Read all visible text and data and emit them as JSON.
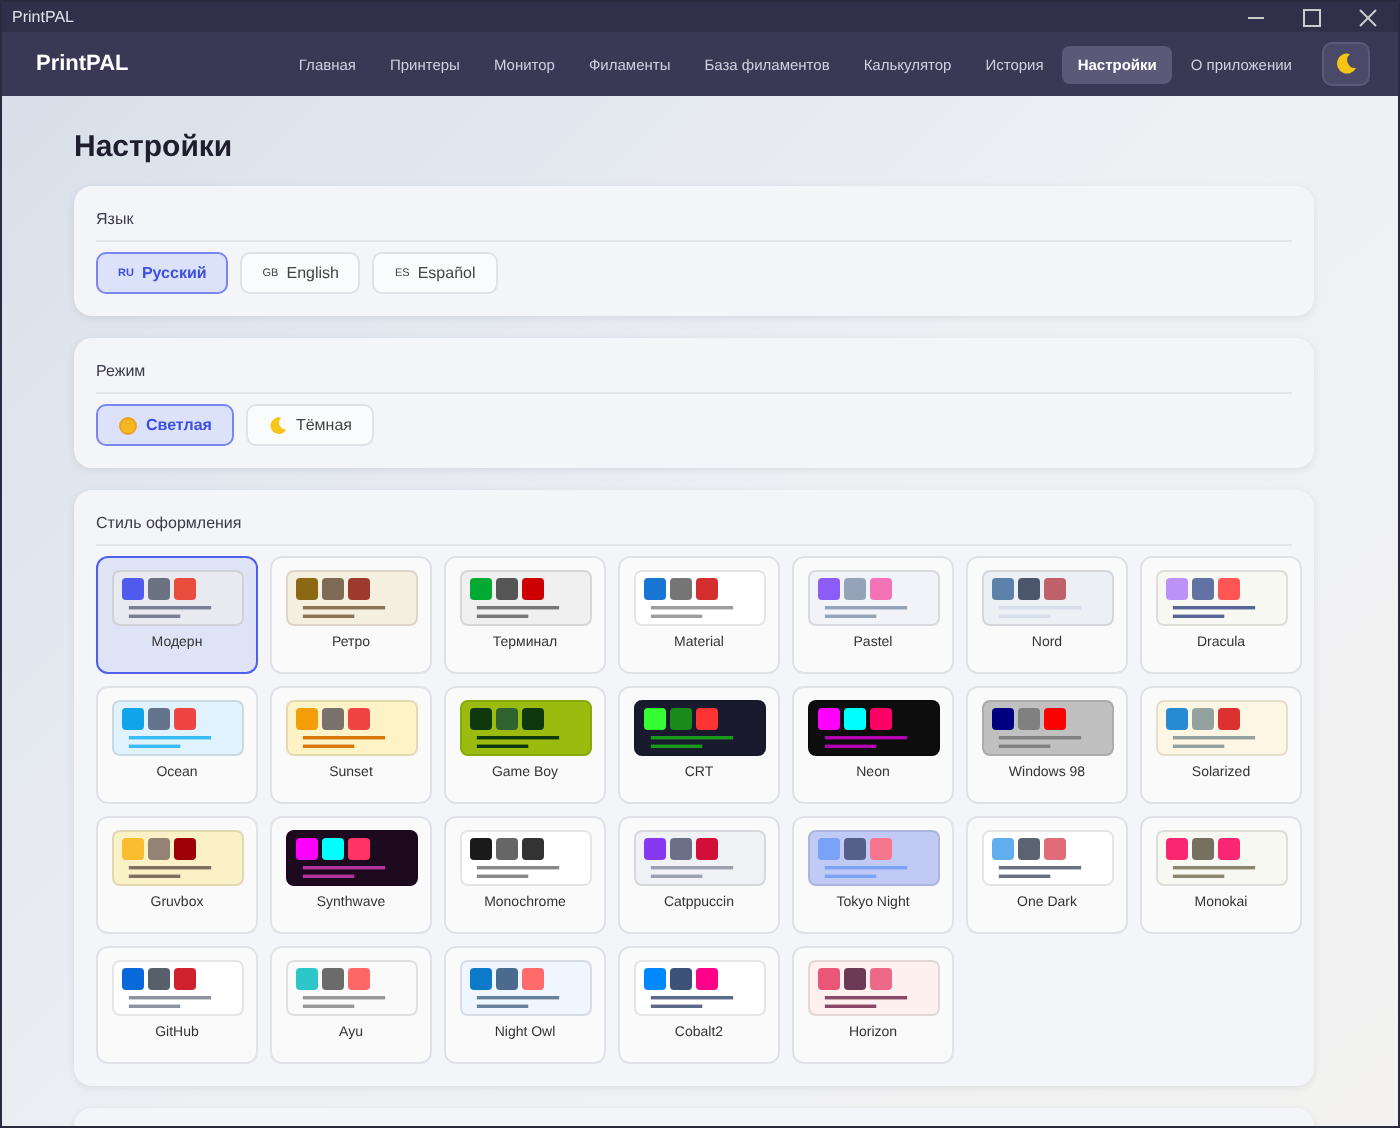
{
  "window": {
    "title": "PrintPAL"
  },
  "app_name": "PrintPAL",
  "nav": [
    {
      "label": "Главная",
      "selected": false
    },
    {
      "label": "Принтеры",
      "selected": false
    },
    {
      "label": "Монитор",
      "selected": false
    },
    {
      "label": "Филаменты",
      "selected": false
    },
    {
      "label": "База филаментов",
      "selected": false
    },
    {
      "label": "Калькулятор",
      "selected": false
    },
    {
      "label": "История",
      "selected": false
    },
    {
      "label": "Настройки",
      "selected": true
    },
    {
      "label": "О приложении",
      "selected": false
    }
  ],
  "page_title": "Настройки",
  "language": {
    "title": "Язык",
    "options": [
      {
        "flag": "RU",
        "label": "Русский",
        "selected": true
      },
      {
        "flag": "GB",
        "label": "English",
        "selected": false
      },
      {
        "flag": "ES",
        "label": "Español",
        "selected": false
      }
    ]
  },
  "mode": {
    "title": "Режим",
    "options": [
      {
        "kind": "sun",
        "label": "Светлая",
        "selected": true
      },
      {
        "kind": "moon",
        "label": "Тёмная",
        "selected": false
      }
    ]
  },
  "style": {
    "title": "Стиль оформления",
    "themes": [
      {
        "name": "Модерн",
        "selected": true,
        "preview": {
          "color": "#e8eaf0"
        },
        "swatches": [
          {
            "color": "#4f5bef"
          },
          {
            "color": "#6b7280"
          },
          {
            "color": "#e74c3c"
          }
        ],
        "line": {
          "color": "#7a7f96"
        }
      },
      {
        "name": "Ретро",
        "selected": false,
        "preview": {
          "color": "#f5efe0"
        },
        "swatches": [
          {
            "color": "#8b6914"
          },
          {
            "color": "#7d6b55"
          },
          {
            "color": "#9c3a2e"
          }
        ],
        "line": {
          "color": "#8b7355"
        }
      },
      {
        "name": "Терминал",
        "selected": false,
        "preview": {
          "color": "#f0f0f0"
        },
        "swatches": [
          {
            "color": "#00aa33"
          },
          {
            "color": "#555555"
          },
          {
            "color": "#cc0000"
          }
        ],
        "line": {
          "color": "#777777"
        }
      },
      {
        "name": "Material",
        "selected": false,
        "preview": {
          "color": "#ffffff"
        },
        "swatches": [
          {
            "color": "#1976d2"
          },
          {
            "color": "#757575"
          },
          {
            "color": "#d32f2f"
          }
        ],
        "line": {
          "color": "#9e9e9e"
        }
      },
      {
        "name": "Pastel",
        "selected": false,
        "preview": {
          "color": "#f1f3f8"
        },
        "swatches": [
          {
            "color": "#8b5cf6"
          },
          {
            "color": "#94a3b8"
          },
          {
            "color": "#f472b6"
          }
        ],
        "line": {
          "color": "#94a3b8"
        }
      },
      {
        "name": "Nord",
        "selected": false,
        "preview": {
          "color": "#eceff4"
        },
        "swatches": [
          {
            "color": "#5e81ac"
          },
          {
            "color": "#4c566a"
          },
          {
            "color": "#bf616a"
          }
        ],
        "line": {
          "color": "#d8dee9"
        }
      },
      {
        "name": "Dracula",
        "selected": false,
        "preview": {
          "color": "#f8f8f2"
        },
        "swatches": [
          {
            "color": "#bd93f9"
          },
          {
            "color": "#6272a4"
          },
          {
            "color": "#ff5555"
          }
        ],
        "line": {
          "color": "#5a6496"
        }
      },
      {
        "name": "Ocean",
        "selected": false,
        "preview": {
          "color": "#e0f2fe"
        },
        "swatches": [
          {
            "color": "#0ea5e9"
          },
          {
            "color": "#64748b"
          },
          {
            "color": "#ef4444"
          }
        ],
        "line": {
          "color": "#38bdf8"
        }
      },
      {
        "name": "Sunset",
        "selected": false,
        "preview": {
          "color": "#fef3c7"
        },
        "swatches": [
          {
            "color": "#f59e0b"
          },
          {
            "color": "#78716c"
          },
          {
            "color": "#ef4444"
          }
        ],
        "line": {
          "color": "#d97706"
        }
      },
      {
        "name": "Game Boy",
        "selected": false,
        "preview": {
          "color": "#9bbc0f"
        },
        "swatches": [
          {
            "color": "#0f380f"
          },
          {
            "color": "#306230"
          },
          {
            "color": "#0f380f"
          }
        ],
        "line": {
          "color": "#0f380f"
        }
      },
      {
        "name": "CRT",
        "selected": false,
        "preview": {
          "color": "#1a1a2e"
        },
        "swatches": [
          {
            "color": "#33ff33"
          },
          {
            "color": "#1a8a1a"
          },
          {
            "color": "#ff3333"
          }
        ],
        "line": {
          "color": "#1a9a1a"
        }
      },
      {
        "name": "Neon",
        "selected": false,
        "preview": {
          "color": "#0d0d0d"
        },
        "swatches": [
          {
            "color": "#ff00ff"
          },
          {
            "color": "#00ffff"
          },
          {
            "color": "#ff0066"
          }
        ],
        "line": {
          "color": "#b000b0"
        }
      },
      {
        "name": "Windows 98",
        "selected": false,
        "preview": {
          "color": "#c0c0c0"
        },
        "swatches": [
          {
            "color": "#000080"
          },
          {
            "color": "#808080"
          },
          {
            "color": "#ff0000"
          }
        ],
        "line": {
          "color": "#808080"
        }
      },
      {
        "name": "Solarized",
        "selected": false,
        "preview": {
          "color": "#fdf6e3"
        },
        "swatches": [
          {
            "color": "#268bd2"
          },
          {
            "color": "#93a1a1"
          },
          {
            "color": "#dc322f"
          }
        ],
        "line": {
          "color": "#93a1a1"
        }
      },
      {
        "name": "Gruvbox",
        "selected": false,
        "preview": {
          "color": "#fbf1c7"
        },
        "swatches": [
          {
            "color": "#fabd2f"
          },
          {
            "color": "#928374"
          },
          {
            "color": "#9d0006"
          }
        ],
        "line": {
          "color": "#7c6f64"
        }
      },
      {
        "name": "Synthwave",
        "selected": false,
        "preview": {
          "color": "#1e0a1e"
        },
        "swatches": [
          {
            "color": "#ff00ff"
          },
          {
            "color": "#00ffff"
          },
          {
            "color": "#ff3366"
          }
        ],
        "line": {
          "color": "#b0329a"
        }
      },
      {
        "name": "Monochrome",
        "selected": false,
        "preview": {
          "color": "#ffffff"
        },
        "swatches": [
          {
            "color": "#1a1a1a"
          },
          {
            "color": "#666666"
          },
          {
            "color": "#333333"
          }
        ],
        "line": {
          "color": "#888888"
        }
      },
      {
        "name": "Catppuccin",
        "selected": false,
        "preview": {
          "color": "#eff1f5"
        },
        "swatches": [
          {
            "color": "#8839ef"
          },
          {
            "color": "#6c6f85"
          },
          {
            "color": "#d20f39"
          }
        ],
        "line": {
          "color": "#9ca0b0"
        }
      },
      {
        "name": "Tokyo Night",
        "selected": false,
        "preview": {
          "color": "#c0caf5"
        },
        "swatches": [
          {
            "color": "#7aa2f7"
          },
          {
            "color": "#565f89"
          },
          {
            "color": "#f7768e"
          }
        ],
        "line": {
          "color": "#7aa2f7"
        }
      },
      {
        "name": "One Dark",
        "selected": false,
        "preview": {
          "color": "#ffffff"
        },
        "swatches": [
          {
            "color": "#61afef"
          },
          {
            "color": "#5c6370"
          },
          {
            "color": "#e06c75"
          }
        ],
        "line": {
          "color": "#6b7080"
        }
      },
      {
        "name": "Monokai",
        "selected": false,
        "preview": {
          "color": "#f8f8f2"
        },
        "swatches": [
          {
            "color": "#f92672"
          },
          {
            "color": "#75715e"
          },
          {
            "color": "#f92672"
          }
        ],
        "line": {
          "color": "#8a8770"
        }
      },
      {
        "name": "GitHub",
        "selected": false,
        "preview": {
          "color": "#ffffff"
        },
        "swatches": [
          {
            "color": "#0969da"
          },
          {
            "color": "#57606a"
          },
          {
            "color": "#cf222e"
          }
        ],
        "line": {
          "color": "#8c959f"
        }
      },
      {
        "name": "Ayu",
        "selected": false,
        "preview": {
          "color": "#fafafa"
        },
        "swatches": [
          {
            "color": "#2ec7c9"
          },
          {
            "color": "#6b6b6b"
          },
          {
            "color": "#ff6666"
          }
        ],
        "line": {
          "color": "#999999"
        }
      },
      {
        "name": "Night Owl",
        "selected": false,
        "preview": {
          "color": "#f0f6ff"
        },
        "swatches": [
          {
            "color": "#0c7ac9"
          },
          {
            "color": "#4b6a8f"
          },
          {
            "color": "#ff6b6b"
          }
        ],
        "line": {
          "color": "#6a7f99"
        }
      },
      {
        "name": "Cobalt2",
        "selected": false,
        "preview": {
          "color": "#ffffff"
        },
        "swatches": [
          {
            "color": "#0088ff"
          },
          {
            "color": "#3d5278"
          },
          {
            "color": "#ff0088"
          }
        ],
        "line": {
          "color": "#5a6a88"
        }
      },
      {
        "name": "Horizon",
        "selected": false,
        "preview": {
          "color": "#fdf0ee"
        },
        "swatches": [
          {
            "color": "#e95678"
          },
          {
            "color": "#6c3a57"
          },
          {
            "color": "#ec6a88"
          }
        ],
        "line": {
          "color": "#8a4868"
        }
      }
    ]
  }
}
